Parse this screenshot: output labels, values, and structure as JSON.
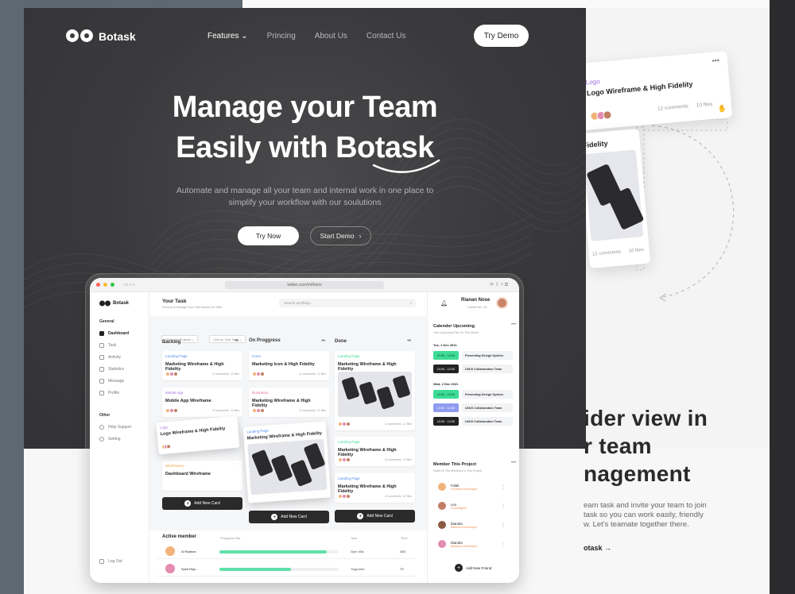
{
  "brand": {
    "name": "Botask"
  },
  "nav": {
    "items": [
      "Features",
      "Princing",
      "About Us",
      "Contact Us"
    ],
    "cta": "Try Demo"
  },
  "hero": {
    "title_line1": "Manage your Team",
    "title_line2": "Easily with Botask",
    "subtitle_line1": "Automate and manage all your team and internal work in one place to",
    "subtitle_line2": "simplify your workflow with our soulutions",
    "btn_primary": "Try Now",
    "btn_secondary": "Start Demo"
  },
  "app": {
    "url": "twitter.com/mrthenx",
    "logo": "Botask",
    "sidebar": {
      "general_label": "General",
      "items": [
        "Dashboard",
        "Task",
        "Activity",
        "Statistics",
        "Message",
        "Profile"
      ],
      "other_label": "Other",
      "other_items": [
        "Help Support",
        "Setting"
      ],
      "logout": "Log Out"
    },
    "header": {
      "title": "Your Task",
      "subtitle": "Keep And Manage Your Task Based On Path",
      "search_placeholder": "Search anything..."
    },
    "filters": [
      "Show: All Projects",
      "Sort by: Due Time"
    ],
    "columns": {
      "backlog": "Backlog",
      "progress": "On Proggress",
      "done": "Done"
    },
    "cards": {
      "b1": {
        "cat": "Landing Page",
        "title": "Marketing Wireframe & High Fidelity",
        "comments": "12 comments",
        "files": "12 files"
      },
      "b2": {
        "cat": "Mobile App",
        "title": "Mobile App Wireframe",
        "comments": "12 comments",
        "files": "12 files"
      },
      "b3": {
        "cat": "Wireframes",
        "title": "Dashboard Wireframe"
      },
      "p1": {
        "cat": "Icons",
        "title": "Marketing Icon & High Fidelity",
        "comments": "12 comments",
        "files": "12 files"
      },
      "p2": {
        "cat": "Illustration",
        "title": "Marketing Wireframe & High Fidelity",
        "comments": "12 comments",
        "files": "12 files"
      },
      "p3": {
        "cat": "Landing Page",
        "title": "Marketing Wireframe & High Fidelity"
      },
      "d1": {
        "cat": "Landing Page",
        "title": "Marketing Wireframe & High Fidelity",
        "comments": "12 comments",
        "files": "12 files"
      },
      "d2": {
        "cat": "Landing Page",
        "title": "Marketing Wireframe & High Fidelity",
        "comments": "12 comments",
        "files": "12 files"
      },
      "d3": {
        "cat": "Landing Page",
        "title": "Marketing Wireframe & High Fidelity",
        "comments": "12 comments",
        "files": "12 files"
      },
      "drag": {
        "cat": "Logo",
        "title": "Logo Wireframe & High Fidelity"
      }
    },
    "add_card": "Add New Card",
    "active": {
      "title": "Active member",
      "cols": [
        "Proggress Bar",
        "Task",
        "Time"
      ],
      "rows": [
        {
          "name": "Al Radhan",
          "progress": 0.9,
          "task": "Gym 40d",
          "time": "28D"
        },
        {
          "name": "Syed Rojo",
          "progress": 0.6,
          "task": "Yoga mini",
          "time": "7D"
        }
      ]
    },
    "user": {
      "name": "Rianan Nose",
      "location": "California, US"
    },
    "calendar": {
      "title": "Calender Upcoming",
      "subtitle": "Your Upcoming Plan On This Month",
      "days": [
        {
          "date": "Tue, 1 Dec 2021",
          "events": [
            {
              "time": "10:00 - 12:00",
              "label": "Presenting Design System",
              "color": "#3ddc97"
            },
            {
              "time": "10:00 - 12:00",
              "label": "UI/UX Collaboration Team",
              "color": "#222222"
            }
          ]
        },
        {
          "date": "Wed, 2 Dec 2021",
          "events": [
            {
              "time": "10:00 - 12:00",
              "label": "Presenting Design System",
              "color": "#3ddc97"
            },
            {
              "time": "10:00 - 12:00",
              "label": "UI/UX Collaboration Team",
              "color": "#8f9cf0"
            },
            {
              "time": "10:00 - 12:00",
              "label": "UI/UX Collaboration Team",
              "color": "#222222"
            }
          ]
        }
      ]
    },
    "members": {
      "title": "Member This Project",
      "subtitle": "Notes Of The Members In This Project",
      "list": [
        {
          "name": "Falah",
          "role": "Frontend Developer"
        },
        {
          "name": "Leo",
          "role": "UI Designer"
        },
        {
          "name": "Diandra",
          "role": "Backend Developer"
        },
        {
          "name": "Diandra",
          "role": "Backend Developer"
        }
      ],
      "add": "Add New Friend"
    }
  },
  "float": {
    "cat": "Logo",
    "title": "Logo Wireframe & High Fidelity",
    "comments": "12 comments",
    "files": "10 files",
    "card2_title": "Fidelity",
    "card2_comments": "12 comments",
    "card2_files": "10 files"
  },
  "section": {
    "line1": "ider view in",
    "line2": "r team",
    "line3": "nagement",
    "para1": "eam task and invite your team to join",
    "para2": "task so you can work easily, friendly",
    "para3": "w. Let's teamate together there.",
    "link": "otask"
  }
}
